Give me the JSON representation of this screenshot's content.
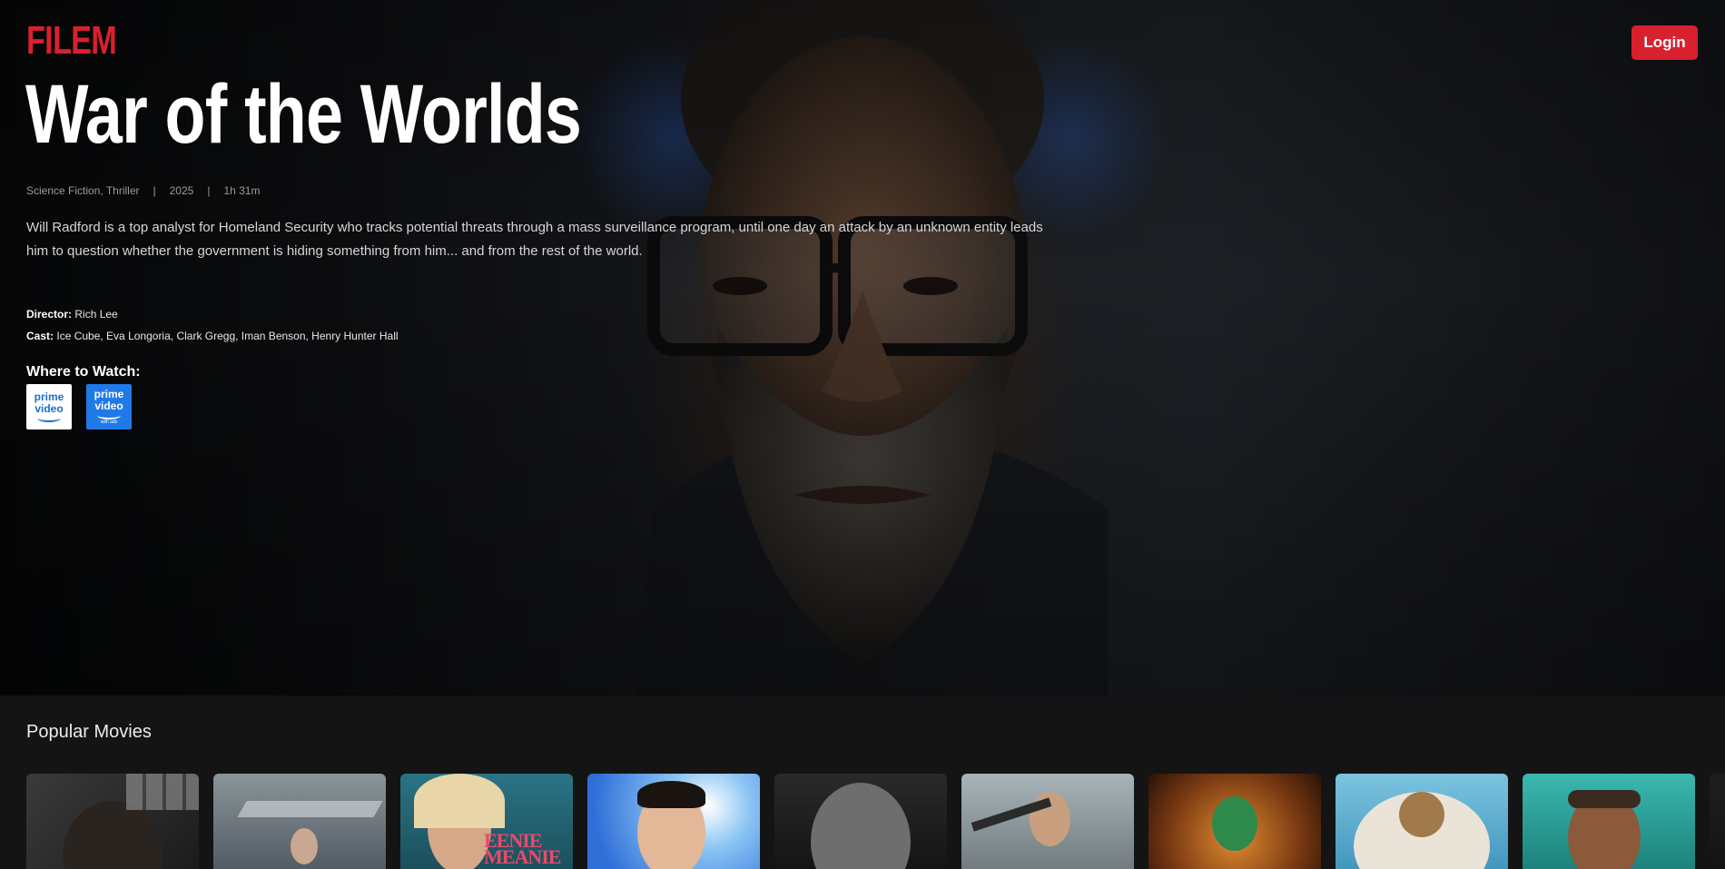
{
  "brand": {
    "name": "FILEM",
    "accent": "#d8202e"
  },
  "header": {
    "login_label": "Login"
  },
  "featured": {
    "title": "War of the Worlds",
    "genres": "Science Fiction, Thriller",
    "year": "2025",
    "runtime": "1h 31m",
    "separator": "|",
    "synopsis": "Will Radford is a top analyst for Homeland Security who tracks potential threats through a mass surveillance program, until one day an attack by an unknown entity leads him to question whether the government is hiding something from him... and from the rest of the world.",
    "director_label": "Director:",
    "director": "Rich Lee",
    "cast_label": "Cast:",
    "cast": "Ice Cube, Eva Longoria, Clark Gregg, Iman Benson, Henry Hunter Hall",
    "where_to_watch_label": "Where to Watch:",
    "providers": [
      {
        "icon": "prime-video-icon",
        "line1": "prime",
        "line2": "video",
        "sub": "",
        "bg": "#ffffff"
      },
      {
        "icon": "prime-video-with-ads-icon",
        "line1": "prime",
        "line2": "video",
        "sub": "with ads",
        "bg": "#1f7ae8"
      }
    ]
  },
  "popular": {
    "title": "Popular Movies",
    "posters": [
      {
        "icon": "poster-1",
        "colors": [
          "#2c2c2c",
          "#8a8a8a"
        ]
      },
      {
        "icon": "poster-2",
        "colors": [
          "#5a6670",
          "#9aa3a8"
        ]
      },
      {
        "icon": "poster-3",
        "colors": [
          "#1f5f6e",
          "#c89a7a"
        ],
        "text": "EENIE MEANIE"
      },
      {
        "icon": "poster-4",
        "colors": [
          "#2f6fd8",
          "#e9c7a8"
        ]
      },
      {
        "icon": "poster-5",
        "colors": [
          "#1e1e1e",
          "#6a6a6a"
        ]
      },
      {
        "icon": "poster-6",
        "colors": [
          "#7a8a90",
          "#c8b89a"
        ]
      },
      {
        "icon": "poster-7",
        "colors": [
          "#5a2a10",
          "#d07a2a"
        ]
      },
      {
        "icon": "poster-8",
        "colors": [
          "#6ab6d8",
          "#e8e0d0"
        ]
      },
      {
        "icon": "poster-9",
        "colors": [
          "#2fa8a0",
          "#8a5a3a"
        ]
      },
      {
        "icon": "poster-10",
        "colors": [
          "#222222",
          "#444444"
        ]
      }
    ]
  }
}
